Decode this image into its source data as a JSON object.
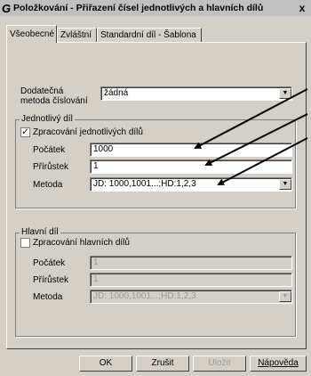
{
  "window": {
    "title": "Položkování - Přiřazení čísel jednotlivých a hlavních dílů",
    "close_label": "x"
  },
  "tabs": [
    {
      "label": "Všeobecné",
      "active": true
    },
    {
      "label": "Zvláštní",
      "active": false
    },
    {
      "label": "Standardní díl - Šablona",
      "active": false
    }
  ],
  "general": {
    "method_label": "Dodatečná metoda číslování",
    "method_value": "žádná"
  },
  "single_part": {
    "group_title": "Jednotlivý díl",
    "checkbox_label": "Zpracování jednotlivých dílů",
    "checked": true,
    "start_label": "Počátek",
    "start_value": "1000",
    "increment_label": "Přírůstek",
    "increment_value": "1",
    "method_label": "Metoda",
    "method_value": "JD: 1000,1001...;HD:1,2,3"
  },
  "main_part": {
    "group_title": "Hlavní díl",
    "checkbox_label": "Zpracování hlavních dílů",
    "checked": false,
    "start_label": "Počátek",
    "start_value": "1",
    "increment_label": "Přírůstek",
    "increment_value": "1",
    "method_label": "Metoda",
    "method_value": "JD: 1000,1001...;HD:1,2,3"
  },
  "buttons": {
    "ok": "OK",
    "cancel": "Zrušit",
    "save": "Uložit",
    "help": "Nápověda"
  },
  "colors": {
    "dialog_bg": "#d4d0c8",
    "arrow": "#000000"
  }
}
